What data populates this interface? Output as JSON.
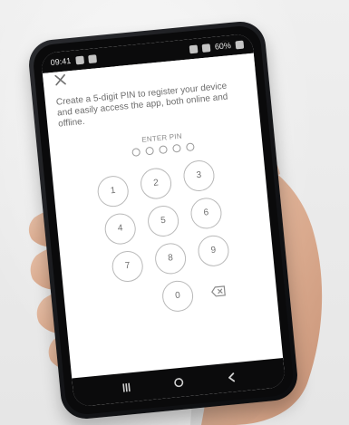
{
  "status_bar": {
    "time": "09:41",
    "battery": "60%"
  },
  "pin_screen": {
    "prompt_lines": [
      "Create a 5-digit PIN to register your device",
      "and easily access the app, both online and",
      "offline."
    ],
    "pin_label": "ENTER PIN",
    "pin_length": 5,
    "keys": [
      "1",
      "2",
      "3",
      "4",
      "5",
      "6",
      "7",
      "8",
      "9",
      "0"
    ]
  },
  "icons": {
    "close": "close-icon",
    "backspace": "backspace-icon",
    "nav_recent": "recent-apps-icon",
    "nav_home": "home-icon",
    "nav_back": "back-icon"
  }
}
